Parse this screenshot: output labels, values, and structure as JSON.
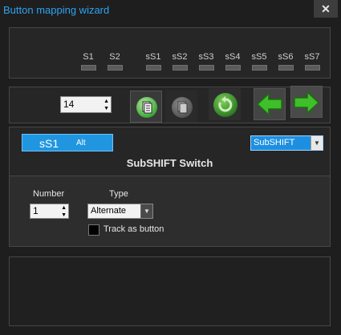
{
  "window": {
    "title": "Button mapping wizard",
    "close_glyph": "✕"
  },
  "switches": [
    "S1",
    "S2",
    "sS1",
    "sS2",
    "sS3",
    "sS4",
    "sS5",
    "sS6",
    "sS7"
  ],
  "toolbar": {
    "number_value": "14",
    "buttons": [
      "copy-icon",
      "paste-icon",
      "reset-icon",
      "arrow-left-icon",
      "arrow-right-icon"
    ]
  },
  "current": {
    "name": "sS1",
    "mode": "Alt",
    "color": "#2196e0"
  },
  "mode_select": {
    "value": "SubSHIFT"
  },
  "section_title": "SubSHIFT Switch",
  "config": {
    "number_label": "Number",
    "number_value": "1",
    "type_label": "Type",
    "type_value": "Alternate",
    "track_label": "Track as button",
    "track_checked": false
  }
}
